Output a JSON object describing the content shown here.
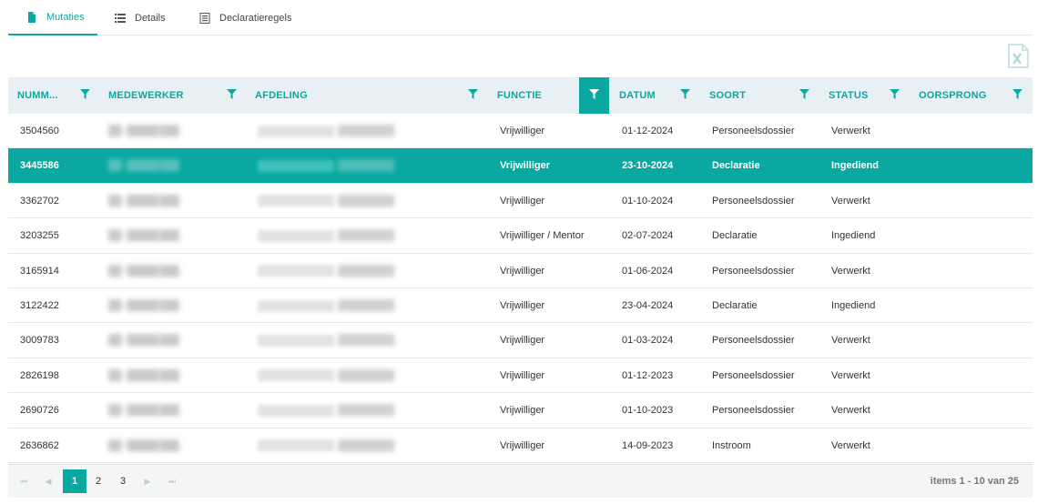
{
  "tabs": [
    {
      "label": "Mutaties",
      "icon": "file-icon",
      "active": true
    },
    {
      "label": "Details",
      "icon": "list-icon",
      "active": false
    },
    {
      "label": "Declaratieregels",
      "icon": "document-list-icon",
      "active": false
    }
  ],
  "toolbar": {
    "export_icon": "excel-export-icon"
  },
  "columns": [
    "NUMM...",
    "MEDEWERKER",
    "AFDELING",
    "FUNCTIE",
    "DATUM",
    "SOORT",
    "STATUS",
    "OORSPRONG"
  ],
  "rows": [
    {
      "nummer": "3504560",
      "medewerker": "",
      "afdeling": "",
      "functie": "Vrijwilliger",
      "datum": "01-12-2024",
      "soort": "Personeelsdossier",
      "status": "Verwerkt",
      "oorsprong": ""
    },
    {
      "nummer": "3445586",
      "medewerker": "",
      "afdeling": "",
      "functie": "Vrijwilliger",
      "datum": "23-10-2024",
      "soort": "Declaratie",
      "status": "Ingediend",
      "oorsprong": ""
    },
    {
      "nummer": "3362702",
      "medewerker": "",
      "afdeling": "",
      "functie": "Vrijwilliger",
      "datum": "01-10-2024",
      "soort": "Personeelsdossier",
      "status": "Verwerkt",
      "oorsprong": ""
    },
    {
      "nummer": "3203255",
      "medewerker": "",
      "afdeling": "",
      "functie": "Vrijwilliger / Mentor",
      "datum": "02-07-2024",
      "soort": "Declaratie",
      "status": "Ingediend",
      "oorsprong": ""
    },
    {
      "nummer": "3165914",
      "medewerker": "",
      "afdeling": "",
      "functie": "Vrijwilliger",
      "datum": "01-06-2024",
      "soort": "Personeelsdossier",
      "status": "Verwerkt",
      "oorsprong": ""
    },
    {
      "nummer": "3122422",
      "medewerker": "",
      "afdeling": "",
      "functie": "Vrijwilliger",
      "datum": "23-04-2024",
      "soort": "Declaratie",
      "status": "Ingediend",
      "oorsprong": ""
    },
    {
      "nummer": "3009783",
      "medewerker": "",
      "afdeling": "",
      "functie": "Vrijwilliger",
      "datum": "01-03-2024",
      "soort": "Personeelsdossier",
      "status": "Verwerkt",
      "oorsprong": ""
    },
    {
      "nummer": "2826198",
      "medewerker": "",
      "afdeling": "",
      "functie": "Vrijwilliger",
      "datum": "01-12-2023",
      "soort": "Personeelsdossier",
      "status": "Verwerkt",
      "oorsprong": ""
    },
    {
      "nummer": "2690726",
      "medewerker": "",
      "afdeling": "",
      "functie": "Vrijwilliger",
      "datum": "01-10-2023",
      "soort": "Personeelsdossier",
      "status": "Verwerkt",
      "oorsprong": ""
    },
    {
      "nummer": "2636862",
      "medewerker": "",
      "afdeling": "",
      "functie": "Vrijwilliger",
      "datum": "14-09-2023",
      "soort": "Instroom",
      "status": "Verwerkt",
      "oorsprong": ""
    }
  ],
  "selected_row_index": 1,
  "pager": {
    "first": "⏮",
    "prev": "◀",
    "next": "▶",
    "last": "⏭",
    "pages": [
      "1",
      "2",
      "3"
    ],
    "current": "1",
    "info": "items 1 - 10 van 25"
  },
  "colors": {
    "accent": "#0aa8a0",
    "header_bg": "#e9f0f3",
    "pager_bg": "#f3f5f6"
  }
}
